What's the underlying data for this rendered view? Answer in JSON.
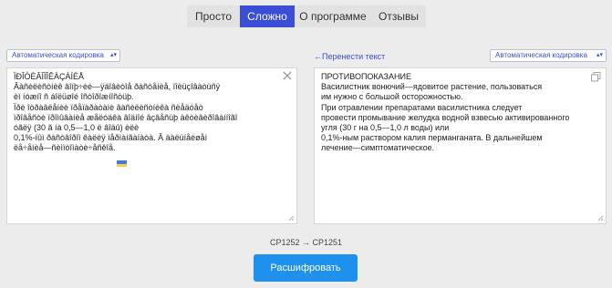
{
  "nav": {
    "tabs": [
      {
        "label": "Просто",
        "active": false
      },
      {
        "label": "Сложно",
        "active": true
      },
      {
        "label": "О программе",
        "active": false
      },
      {
        "label": "Отзывы",
        "active": false
      }
    ]
  },
  "left_panel": {
    "encoding_select": "Автоматическая кодировка",
    "input_text": "ÏÐÎÒÈÂÎÏÎÊÀÇÀÍÈÅ\nÂàñèëèñòíèê âîíþ÷èé—ÿäîâèòîå ðàñòåíèå, ïîëüçîâàòüñÿ\nèì íóæíî ñ áîëüøîé îñòîðîæíîñòüþ.\nÏðè îòðàâëåíèè ïðåïàðàòàìè âàñèëèñòíèêà ñëåäóåò\nïðîâåñòè ïðîìûâàíèå æåëóäêà âîäíîé âçâåñüþ àêòèâèðîâàííîãî\nóãëÿ (30 ã íà 0,5—1,0 ë âîäû) èëè\n0,1%-íûì ðàñòâîðîì êàëèÿ ïåðìàíãàíàòà. Â äàëüíåéøåì\nëå÷åíèå—ñèìïòîìàòè÷åñêîå."
  },
  "right_panel": {
    "transfer_link": "←Перенести текст",
    "encoding_select": "Автоматическая кодировка",
    "output_text": "ПРОТИВОПОКАЗАНИЕ\nВасилистник вонючий—ядовитое растение, пользоваться\nим нужно с большой осторожностью.\nПри отравлении препаратами василистника следует\nпровести промывание желудка водной взвесью активированного\nугля (30 г на 0,5—1,0 л воды) или\n0,1%-ным раствором калия перманганата. В дальнейшем\nлечение—симптоматическое."
  },
  "codepage": "CP1252 → CP1251",
  "decode_button": "Расшифровать",
  "colors": {
    "accent": "#3b4fd6",
    "button": "#1e90ee",
    "background": "#ececec"
  },
  "icons": {
    "select_arrow": "chevron-up-down-icon",
    "clear": "close-icon",
    "copy": "copy-icon",
    "flag": "ukraine-flag-icon"
  }
}
